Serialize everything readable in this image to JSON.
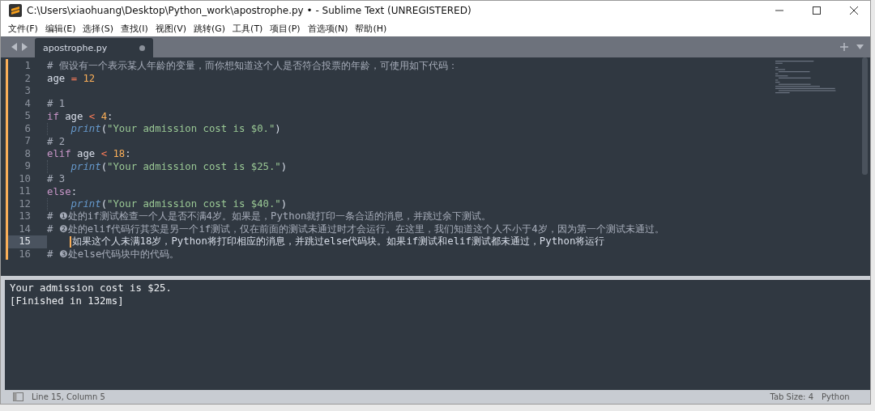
{
  "window": {
    "title": "C:\\Users\\xiaohuang\\Desktop\\Python_work\\apostrophe.py • - Sublime Text (UNREGISTERED)"
  },
  "menu": [
    "文件(F)",
    "编辑(E)",
    "选择(S)",
    "查找(I)",
    "视图(V)",
    "跳转(G)",
    "工具(T)",
    "项目(P)",
    "首选项(N)",
    "帮助(H)"
  ],
  "tabs": [
    {
      "label": "apostrophe.py",
      "selected": true,
      "modified": true
    }
  ],
  "editor": {
    "lines": [
      {
        "number": "1",
        "current": false,
        "tokens": [
          {
            "kind": "comment",
            "text": "# 假设有一个表示某人年龄的变量，而你想知道这个人是否符合投票的年龄，可使用如下代码："
          }
        ]
      },
      {
        "number": "2",
        "current": false,
        "tokens": [
          {
            "kind": "plain",
            "text": "age "
          },
          {
            "kind": "operator",
            "text": "="
          },
          {
            "kind": "number",
            "text": " 12"
          }
        ]
      },
      {
        "number": "3",
        "current": false
      },
      {
        "number": "4",
        "current": false,
        "tokens": [
          {
            "kind": "comment",
            "text": "# 1"
          }
        ]
      },
      {
        "number": "5",
        "current": false,
        "tokens": [
          {
            "kind": "keyword",
            "text": "if"
          },
          {
            "kind": "plain",
            "text": " age "
          },
          {
            "kind": "operator",
            "text": "<"
          },
          {
            "kind": "number",
            "text": " 4"
          },
          {
            "kind": "plain",
            "text": ":"
          }
        ]
      },
      {
        "number": "6",
        "current": false,
        "indented": true,
        "tokens": [
          {
            "kind": "builtin",
            "text": "print"
          },
          {
            "kind": "plain",
            "text": "("
          },
          {
            "kind": "string",
            "text": "\"Your admission cost is $0.\""
          },
          {
            "kind": "plain",
            "text": ")"
          }
        ]
      },
      {
        "number": "7",
        "current": false,
        "tokens": [
          {
            "kind": "comment",
            "text": "# 2"
          }
        ]
      },
      {
        "number": "8",
        "current": false,
        "tokens": [
          {
            "kind": "keyword",
            "text": "elif"
          },
          {
            "kind": "plain",
            "text": " age "
          },
          {
            "kind": "operator",
            "text": "<"
          },
          {
            "kind": "number",
            "text": " 18"
          },
          {
            "kind": "plain",
            "text": ":"
          }
        ]
      },
      {
        "number": "9",
        "current": false,
        "indented": true,
        "tokens": [
          {
            "kind": "builtin",
            "text": "print"
          },
          {
            "kind": "plain",
            "text": "("
          },
          {
            "kind": "string",
            "text": "\"Your admission cost is $25.\""
          },
          {
            "kind": "plain",
            "text": ")"
          }
        ]
      },
      {
        "number": "10",
        "current": false,
        "tokens": [
          {
            "kind": "comment",
            "text": "# 3"
          }
        ]
      },
      {
        "number": "11",
        "current": false,
        "tokens": [
          {
            "kind": "keyword",
            "text": "else"
          },
          {
            "kind": "plain",
            "text": ":"
          }
        ]
      },
      {
        "number": "12",
        "current": false,
        "indented": true,
        "tokens": [
          {
            "kind": "builtin",
            "text": "print"
          },
          {
            "kind": "plain",
            "text": "("
          },
          {
            "kind": "string",
            "text": "\"Your admission cost is $40.\""
          },
          {
            "kind": "plain",
            "text": ")"
          }
        ]
      },
      {
        "number": "13",
        "current": false,
        "tokens": [
          {
            "kind": "comment",
            "text": "# ❶处的if测试检查一个人是否不满4岁。如果是，Python就打印一条合适的消息，并跳过余下测试。"
          }
        ]
      },
      {
        "number": "14",
        "current": false,
        "tokens": [
          {
            "kind": "comment",
            "text": "# ❷处的elif代码行其实是另一个if测试，仅在前面的测试未通过时才会运行。在这里，我们知道这个人不小于4岁，因为第一个测试未通过。"
          }
        ]
      },
      {
        "number": "15",
        "current": true,
        "indented": true,
        "tokens": [
          {
            "kind": "plain",
            "text": "如果这个人未满18岁，Python将打印相应的消息，并跳过else代码块。如果if测试和elif测试都未通过，Python将运行"
          }
        ]
      },
      {
        "number": "16",
        "current": false,
        "tokens": [
          {
            "kind": "comment",
            "text": "# ❸处else代码块中的代码。"
          }
        ]
      }
    ]
  },
  "output": [
    "Your admission cost is $25.",
    "[Finished in 132ms]"
  ],
  "status_bar": {
    "position": "Line 15, Column 5",
    "tab_size": "Tab Size: 4",
    "syntax": "Python"
  }
}
